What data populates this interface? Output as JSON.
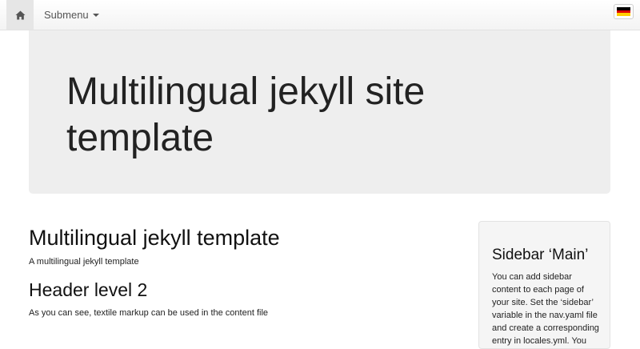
{
  "navbar": {
    "home_icon": "home-icon",
    "submenu_label": "Submenu",
    "language_flag": "german-flag-icon",
    "flag_colors": [
      "#000000",
      "#DD0000",
      "#FFCE00"
    ]
  },
  "jumbotron": {
    "title": "Multilingual jekyll site template"
  },
  "content": {
    "title": "Multilingual jekyll template",
    "subtitle": "A multilingual jekyll template",
    "header2": "Header level 2",
    "paragraph": "As you can see, textile markup can be used in the content file"
  },
  "sidebar": {
    "title": "Sidebar ‘Main’",
    "text": "You can add sidebar content to each page of your site. Set the ‘sidebar’ variable in the nav.yaml file and create a corresponding entry in locales.yml. You"
  }
}
